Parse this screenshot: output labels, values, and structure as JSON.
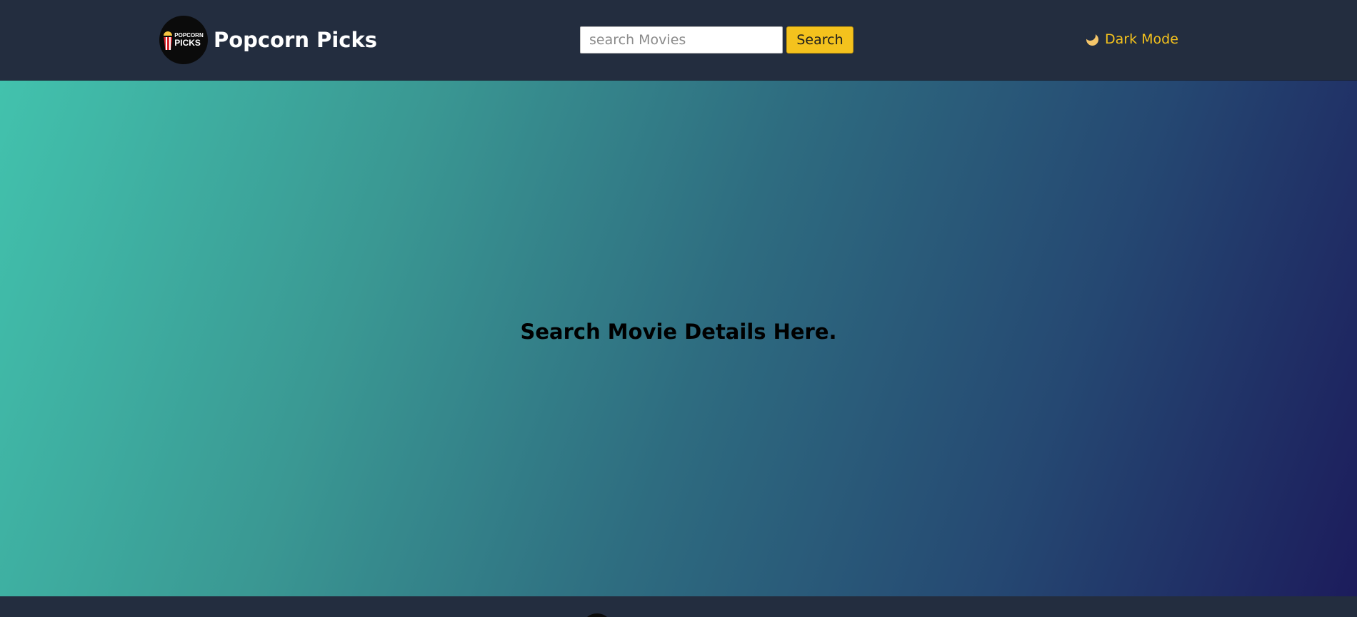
{
  "header": {
    "logo": {
      "line1": "POPCORN",
      "line2": "PICKS",
      "icon": "popcorn-bucket-icon"
    },
    "brand_name": "Popcorn Picks",
    "search": {
      "placeholder": "search Movies",
      "value": "",
      "button_label": "Search"
    },
    "theme_toggle": {
      "icon": "moon-icon",
      "label": "Dark Mode"
    }
  },
  "main": {
    "heading": "Search Movie Details Here."
  },
  "colors": {
    "navbar_bg": "#232d3f",
    "accent": "#f4c21d",
    "gradient_start": "#42c2ad",
    "gradient_end": "#1c1c5c"
  }
}
